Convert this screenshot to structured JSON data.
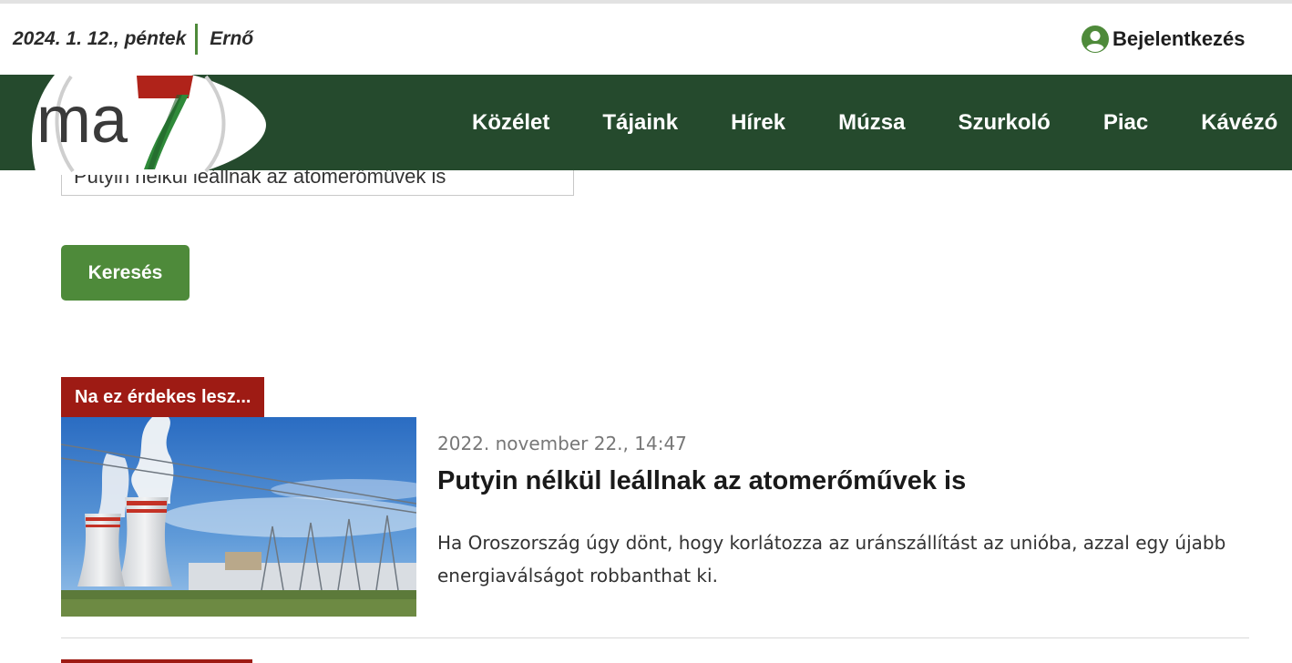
{
  "header": {
    "date": "2024. 1. 12., péntek",
    "nameday": "Ernő",
    "login_label": "Bejelentkezés"
  },
  "nav": {
    "items": [
      {
        "label": "Közélet"
      },
      {
        "label": "Tájaink"
      },
      {
        "label": "Hírek"
      },
      {
        "label": "Múzsa"
      },
      {
        "label": "Szurkoló"
      },
      {
        "label": "Piac"
      },
      {
        "label": "Kávézó"
      }
    ]
  },
  "logo": {
    "text": "ma",
    "numeral": "7"
  },
  "search": {
    "value": "Putyin nélkül leállnak az atomerőművek is",
    "button_label": "Keresés"
  },
  "article": {
    "tag": "Na ez érdekes lesz...",
    "date": "2022. november 22., 14:47",
    "title": "Putyin nélkül leállnak az atomerőművek is",
    "lead": "Ha Oroszország úgy dönt, hogy korlátozza az uránszállítást az unióba, azzal egy újabb energiaválságot robbanthat ki."
  },
  "colors": {
    "nav_bg": "#254a2d",
    "accent_green": "#4e8a3a",
    "tag_red": "#9e1b14",
    "logo_red": "#b0231a"
  }
}
